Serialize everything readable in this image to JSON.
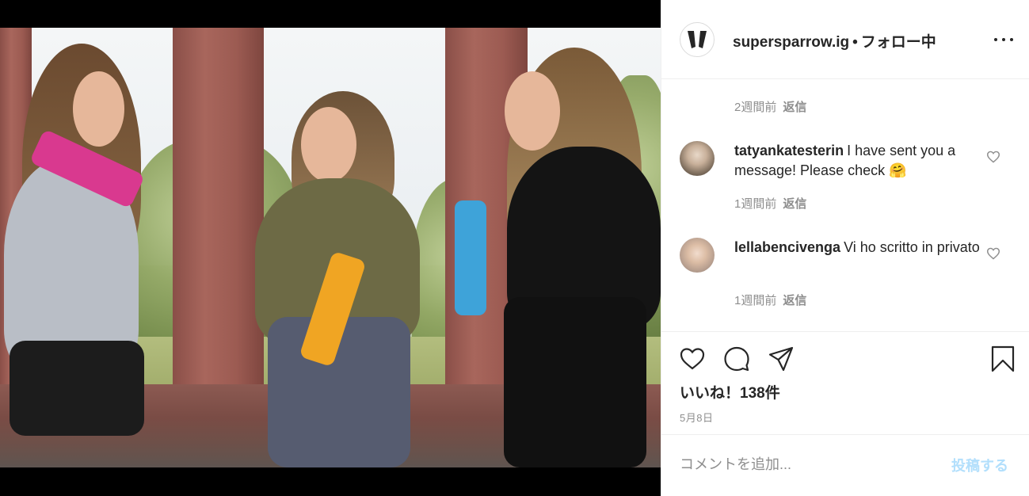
{
  "colors": {
    "text": "#262626",
    "muted": "#8e8e8e",
    "divider": "#efefef",
    "post_button_disabled": "#b2dffc",
    "letterbox": "#000000"
  },
  "post": {
    "image_alt_icon": "photo-girls-with-water-bottles"
  },
  "header": {
    "username": "supersparrow.ig",
    "separator": "•",
    "follow_status": "フォロー中",
    "more_icon": "more-horizontal-icon"
  },
  "comments": {
    "previous_meta": {
      "time": "2週間前",
      "reply": "返信"
    },
    "items": [
      {
        "username": "tatyankatesterin",
        "text": "I have sent you a message! Please check 🤗",
        "time": "1週間前",
        "reply": "返信",
        "heart_icon": "heart-outline-icon"
      },
      {
        "username": "lellabencivenga",
        "text": "Vi ho scritto in privato",
        "time": "1週間前",
        "reply": "返信",
        "heart_icon": "heart-outline-icon"
      }
    ]
  },
  "actions": {
    "like_icon": "heart-outline-icon",
    "comment_icon": "comment-bubble-icon",
    "share_icon": "paper-plane-icon",
    "save_icon": "bookmark-icon",
    "likes_text": "いいね！138件",
    "date": "5月8日"
  },
  "add_comment": {
    "placeholder": "コメントを追加...",
    "post_label": "投稿する"
  }
}
